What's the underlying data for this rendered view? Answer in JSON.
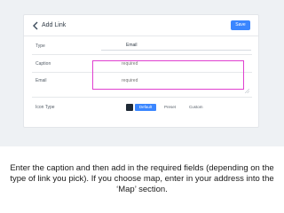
{
  "header": {
    "title": "Add Link",
    "save_label": "Save",
    "back_icon": "chevron-left-icon"
  },
  "form": {
    "type_label": "Type",
    "type_value": "Email",
    "caption_label": "Caption",
    "caption_placeholder": "required",
    "email_label": "Email",
    "email_placeholder": "required",
    "icon_type_label": "Icon Type",
    "icon_options": [
      "Default",
      "Preset",
      "Custom"
    ],
    "icon_selected": "Default"
  },
  "instruction": {
    "line1": "Enter the caption and then add in the required fields (depending on the",
    "line2": "type of link you pick). If you choose map, enter in your address into the",
    "line3": "‘Map’ section."
  },
  "colors": {
    "accent": "#3a86ff",
    "highlight": "#e040d0",
    "background": "#eef1f4"
  }
}
